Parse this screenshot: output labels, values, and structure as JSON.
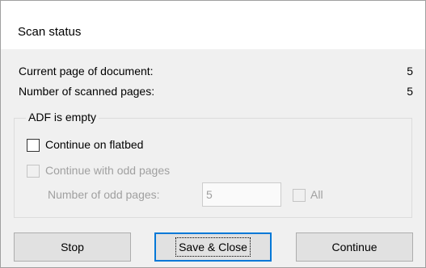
{
  "window": {
    "title": "Scan status"
  },
  "status": {
    "current_page_label": "Current page of document:",
    "current_page_value": "5",
    "scanned_pages_label": "Number of scanned pages:",
    "scanned_pages_value": "5"
  },
  "adf_group": {
    "label": "ADF is empty",
    "continue_flatbed_label": "Continue on flatbed",
    "continue_flatbed_checked": false,
    "continue_odd_label": "Continue with odd pages",
    "continue_odd_checked": false,
    "odd_pages_label": "Number of odd pages:",
    "odd_pages_value": "5",
    "all_label": "All",
    "all_checked": false
  },
  "buttons": {
    "stop": "Stop",
    "save_close": "Save & Close",
    "continue": "Continue"
  }
}
